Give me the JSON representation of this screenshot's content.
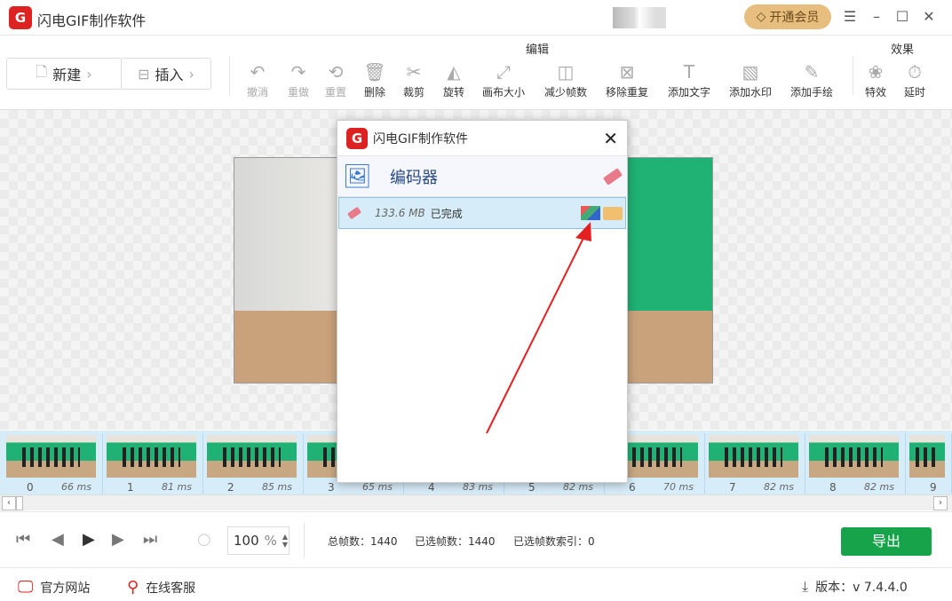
{
  "app": {
    "title": "闪电GIF制作软件",
    "logo_letter": "G",
    "vip_label": "开通会员"
  },
  "window": {
    "menu": "☰",
    "minimize": "–",
    "maximize": "☐",
    "close": "✕"
  },
  "toolbar": {
    "new_label": "新建",
    "insert_label": "插入",
    "edit_group": "编辑",
    "effect_group": "效果",
    "tools": [
      {
        "label": "撤消",
        "icon": "↶",
        "disabled": true
      },
      {
        "label": "重做",
        "icon": "↷",
        "disabled": true
      },
      {
        "label": "重置",
        "icon": "⟲",
        "disabled": true
      },
      {
        "label": "删除",
        "icon": "🗑",
        "disabled": false
      },
      {
        "label": "裁剪",
        "icon": "✂",
        "disabled": false
      },
      {
        "label": "旋转",
        "icon": "◭",
        "disabled": false
      },
      {
        "label": "画布大小",
        "icon": "⤢",
        "disabled": false
      },
      {
        "label": "减少帧数",
        "icon": "◫",
        "disabled": false
      },
      {
        "label": "移除重复",
        "icon": "⊠",
        "disabled": false
      },
      {
        "label": "添加文字",
        "icon": "T",
        "disabled": false
      },
      {
        "label": "添加水印",
        "icon": "▧",
        "disabled": false
      },
      {
        "label": "添加手绘",
        "icon": "✎",
        "disabled": false
      },
      {
        "label": "特效",
        "icon": "❀",
        "disabled": false
      },
      {
        "label": "延时",
        "icon": "⏱",
        "disabled": false
      }
    ]
  },
  "frames": [
    {
      "index": "0",
      "ms": "66 ms"
    },
    {
      "index": "1",
      "ms": "81 ms"
    },
    {
      "index": "2",
      "ms": "85 ms"
    },
    {
      "index": "3",
      "ms": "65 ms"
    },
    {
      "index": "4",
      "ms": "83 ms"
    },
    {
      "index": "5",
      "ms": "82 ms"
    },
    {
      "index": "6",
      "ms": "70 ms"
    },
    {
      "index": "7",
      "ms": "82 ms"
    },
    {
      "index": "8",
      "ms": "82 ms"
    },
    {
      "index": "9",
      "ms": ""
    }
  ],
  "controls": {
    "zoom_value": "100",
    "zoom_unit": "%",
    "total_frames": "总帧数：1440",
    "selected_frames": "已选帧数：1440",
    "selected_index": "已选帧数索引：0",
    "export_label": "导出"
  },
  "footer": {
    "website": "官方网站",
    "support": "在线客服",
    "version": "版本：v 7.4.4.0"
  },
  "dialog": {
    "title": "闪电GIF制作软件",
    "close": "✕",
    "section": "编码器",
    "size": "133.6 MB",
    "status": "已完成"
  },
  "colors": {
    "accent": "#16a34a",
    "brand": "#d22222",
    "arrow": "#e52020"
  }
}
